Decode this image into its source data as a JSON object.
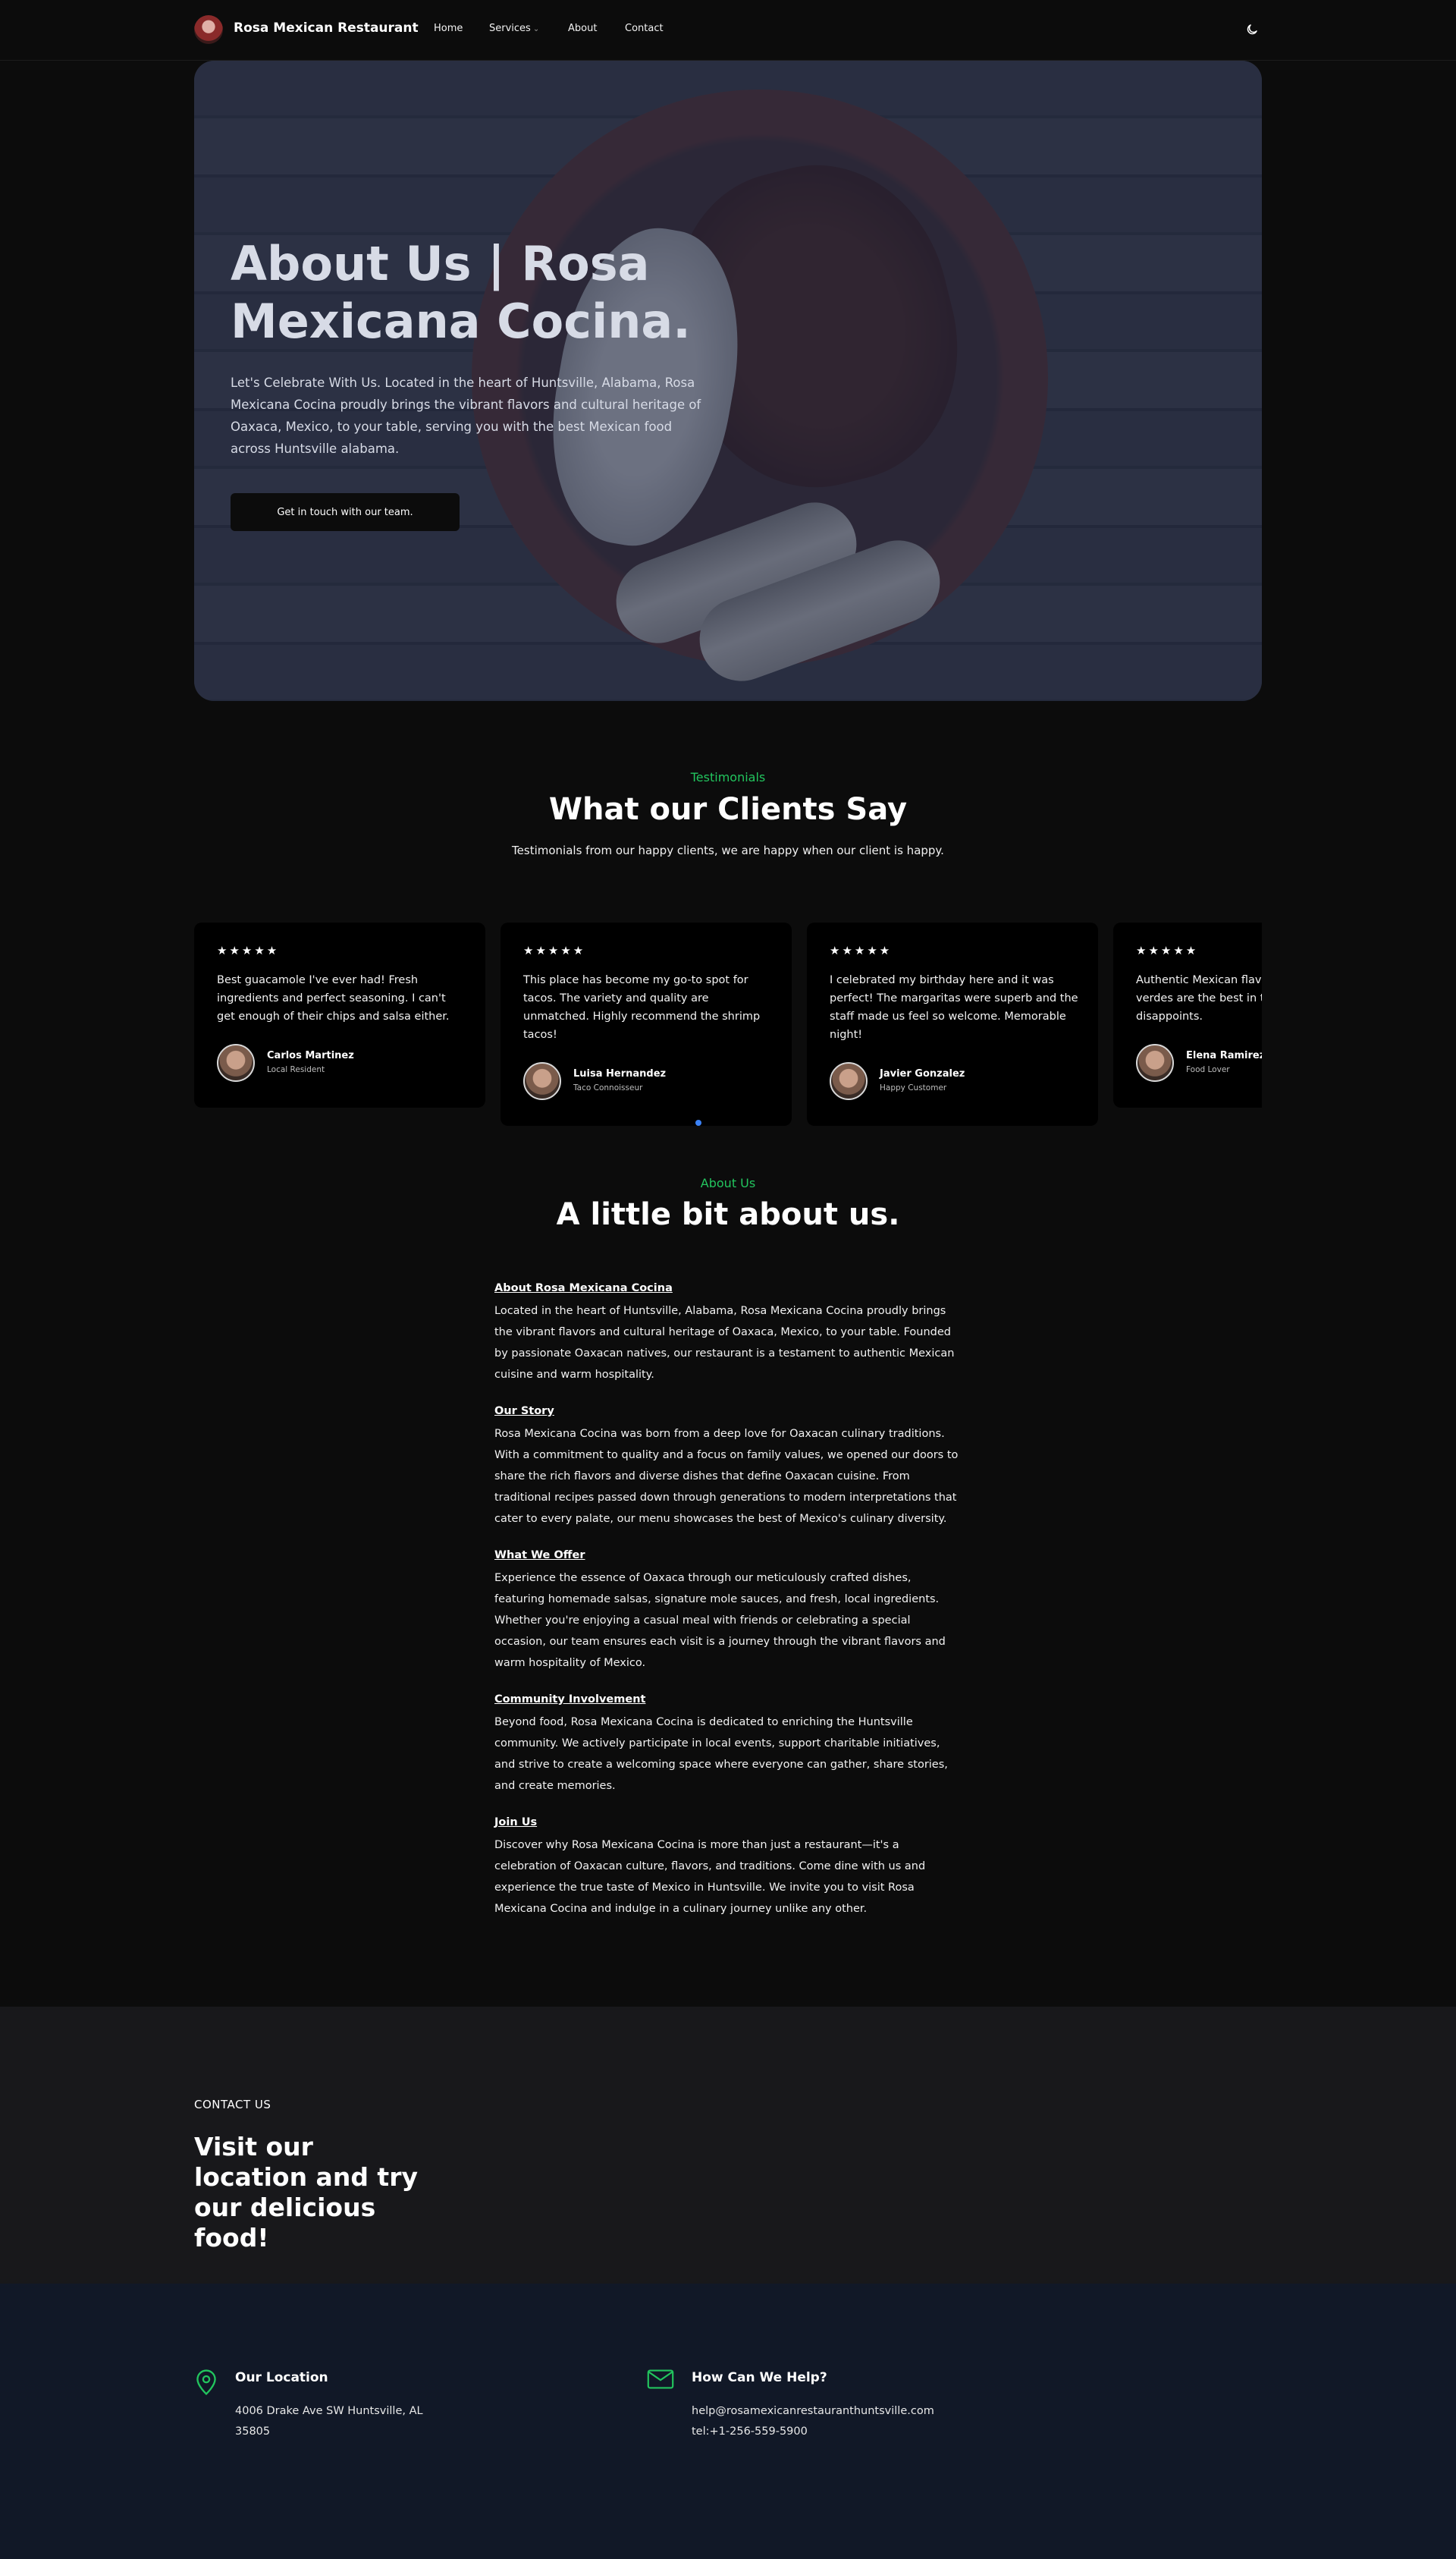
{
  "nav": {
    "brand": "Rosa Mexican Restaurant",
    "links": {
      "home": "Home",
      "services": "Services",
      "about": "About",
      "contact": "Contact"
    }
  },
  "hero": {
    "title": "About Us | Rosa Mexicana Cocina.",
    "text": "Let's Celebrate With Us. Located in the heart of Huntsville, Alabama, Rosa Mexicana Cocina proudly brings the vibrant flavors and cultural heritage of Oaxaca, Mexico, to your table, serving you with the best Mexican food across Huntsville alabama.",
    "button": "Get in touch with our team."
  },
  "testimonials": {
    "eyebrow": "Testimonials",
    "title": "What our Clients Say",
    "subtitle": "Testimonials from our happy clients, we are happy when our client is happy.",
    "items": [
      {
        "stars": "★★★★★",
        "quote": "Best guacamole I've ever had! Fresh ingredients and perfect seasoning. I can't get enough of their chips and salsa either.",
        "name": "Carlos Martinez",
        "role": "Local Resident"
      },
      {
        "stars": "★★★★★",
        "quote": "This place has become my go-to spot for tacos. The variety and quality are unmatched. Highly recommend the shrimp tacos!",
        "name": "Luisa Hernandez",
        "role": "Taco Connoisseur"
      },
      {
        "stars": "★★★★★",
        "quote": "I celebrated my birthday here and it was perfect! The margaritas were superb and the staff made us feel so welcome. Memorable night!",
        "name": "Javier Gonzalez",
        "role": "Happy Customer"
      },
      {
        "stars": "★★★★★",
        "quote": "Authentic Mexican flavors! The enchiladas verdes are the best in town and never disappoints.",
        "name": "Elena Ramirez",
        "role": "Food Lover"
      }
    ]
  },
  "about": {
    "eyebrow": "About Us",
    "title": "A little bit about us.",
    "sections": [
      {
        "heading": "About Rosa Mexicana Cocina",
        "body": "Located in the heart of Huntsville, Alabama, Rosa Mexicana Cocina proudly brings the vibrant flavors and cultural heritage of Oaxaca, Mexico, to your table. Founded by passionate Oaxacan natives, our restaurant is a testament to authentic Mexican cuisine and warm hospitality."
      },
      {
        "heading": "Our Story",
        "body": "Rosa Mexicana Cocina was born from a deep love for Oaxacan culinary traditions. With a commitment to quality and a focus on family values, we opened our doors to share the rich flavors and diverse dishes that define Oaxacan cuisine. From traditional recipes passed down through generations to modern interpretations that cater to every palate, our menu showcases the best of Mexico's culinary diversity."
      },
      {
        "heading": "What We Offer",
        "body": "Experience the essence of Oaxaca through our meticulously crafted dishes, featuring homemade salsas, signature mole sauces, and fresh, local ingredients. Whether you're enjoying a casual meal with friends or celebrating a special occasion, our team ensures each visit is a journey through the vibrant flavors and warm hospitality of Mexico."
      },
      {
        "heading": "Community Involvement",
        "body": "Beyond food, Rosa Mexicana Cocina is dedicated to enriching the Huntsville community. We actively participate in local events, support charitable initiatives, and strive to create a welcoming space where everyone can gather, share stories, and create memories."
      },
      {
        "heading": "Join Us",
        "body": "Discover why Rosa Mexicana Cocina is more than just a restaurant—it's a celebration of Oaxacan culture, flavors, and traditions. Come dine with us and experience the true taste of Mexico in Huntsville. We invite you to visit Rosa Mexicana Cocina and indulge in a culinary journey unlike any other."
      }
    ]
  },
  "contact": {
    "eyebrow": "CONTACT US",
    "title": "Visit our location and try our delicious food!"
  },
  "footer": {
    "location": {
      "heading": "Our Location",
      "address": "4006 Drake Ave SW Huntsville, AL 35805"
    },
    "help": {
      "heading": "How Can We Help?",
      "email": "help@rosamexicanrestauranthuntsville.com",
      "phone": "tel:+1-256-559-5900"
    }
  },
  "colors": {
    "accent": "#22c55e",
    "slider_dot": "#3b82f6",
    "background": "#0c0c0c",
    "contact_bg": "#18181b",
    "footer_bg": "#111827"
  },
  "icons": {
    "logo": "restaurant-logo",
    "theme": "moon-icon",
    "location": "map-pin-icon",
    "help": "envelope-icon"
  }
}
